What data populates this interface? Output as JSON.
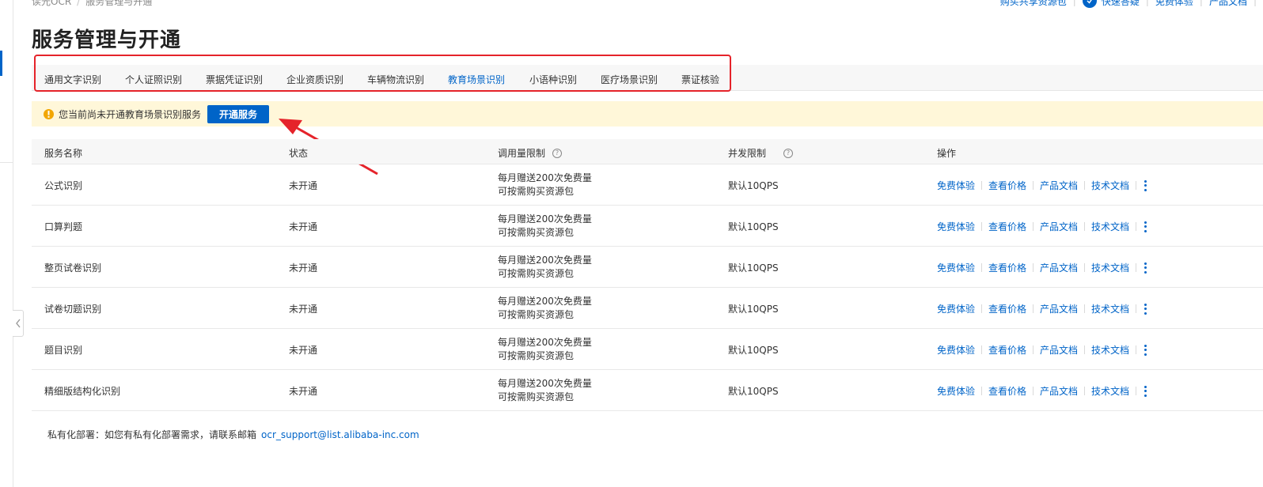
{
  "breadcrumb": [
    "读光OCR",
    "服务管理与开通"
  ],
  "top_links": {
    "buy_resource": "购买共享资源包",
    "quick_start": "快速答疑",
    "free_trial": "免费体验",
    "product_docs": "产品文档"
  },
  "page_title": "服务管理与开通",
  "tabs": [
    {
      "label": "通用文字识别"
    },
    {
      "label": "个人证照识别"
    },
    {
      "label": "票据凭证识别"
    },
    {
      "label": "企业资质识别"
    },
    {
      "label": "车辆物流识别"
    },
    {
      "label": "教育场景识别",
      "active": true
    },
    {
      "label": "小语种识别"
    },
    {
      "label": "医疗场景识别"
    },
    {
      "label": "票证核验"
    }
  ],
  "notice": {
    "text": "您当前尚未开通教育场景识别服务",
    "button": "开通服务"
  },
  "table": {
    "headers": {
      "name": "服务名称",
      "status": "状态",
      "quota": "调用量限制",
      "concurrency": "并发限制",
      "ops": "操作"
    },
    "rows": [
      {
        "name": "公式识别",
        "status": "未开通",
        "quota1": "每月赠送200次免费量",
        "quota2": "可按需购买资源包",
        "concurrency": "默认10QPS"
      },
      {
        "name": "口算判题",
        "status": "未开通",
        "quota1": "每月赠送200次免费量",
        "quota2": "可按需购买资源包",
        "concurrency": "默认10QPS"
      },
      {
        "name": "整页试卷识别",
        "status": "未开通",
        "quota1": "每月赠送200次免费量",
        "quota2": "可按需购买资源包",
        "concurrency": "默认10QPS"
      },
      {
        "name": "试卷切题识别",
        "status": "未开通",
        "quota1": "每月赠送200次免费量",
        "quota2": "可按需购买资源包",
        "concurrency": "默认10QPS"
      },
      {
        "name": "题目识别",
        "status": "未开通",
        "quota1": "每月赠送200次免费量",
        "quota2": "可按需购买资源包",
        "concurrency": "默认10QPS"
      },
      {
        "name": "精细版结构化识别",
        "status": "未开通",
        "quota1": "每月赠送200次免费量",
        "quota2": "可按需购买资源包",
        "concurrency": "默认10QPS"
      }
    ],
    "ops": {
      "free_trial": "免费体验",
      "view_price": "查看价格",
      "product_docs": "产品文档",
      "tech_docs": "技术文档"
    }
  },
  "footer": {
    "label": "私有化部署：如您有私有化部署需求，请联系邮箱",
    "email": "ocr_support@list.alibaba-inc.com"
  },
  "colors": {
    "brand": "#0064c8",
    "highlight": "#e5232a",
    "notice_bg": "#fff7d9",
    "warning": "#f2a600"
  }
}
